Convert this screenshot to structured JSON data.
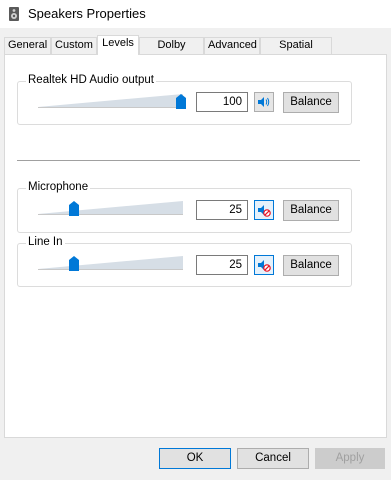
{
  "window": {
    "title": "Speakers Properties",
    "icon": "speaker-icon"
  },
  "tabs": [
    {
      "label": "General",
      "active": false
    },
    {
      "label": "Custom",
      "active": false
    },
    {
      "label": "Levels",
      "active": true
    },
    {
      "label": "Dolby Audio",
      "active": false
    },
    {
      "label": "Advanced",
      "active": false
    },
    {
      "label": "Spatial sound",
      "active": false
    }
  ],
  "levels": {
    "output": {
      "label": "Realtek HD Audio output",
      "value": "100",
      "level": 1.0,
      "muted": false,
      "balance_label": "Balance"
    },
    "microphone": {
      "label": "Microphone",
      "value": "25",
      "level": 0.25,
      "muted": true,
      "balance_label": "Balance"
    },
    "line_in": {
      "label": "Line In",
      "value": "25",
      "level": 0.25,
      "muted": true,
      "balance_label": "Balance"
    }
  },
  "footer": {
    "ok_label": "OK",
    "cancel_label": "Cancel",
    "apply_label": "Apply"
  },
  "colors": {
    "accent": "#0078d7",
    "mute": "#e81123"
  }
}
